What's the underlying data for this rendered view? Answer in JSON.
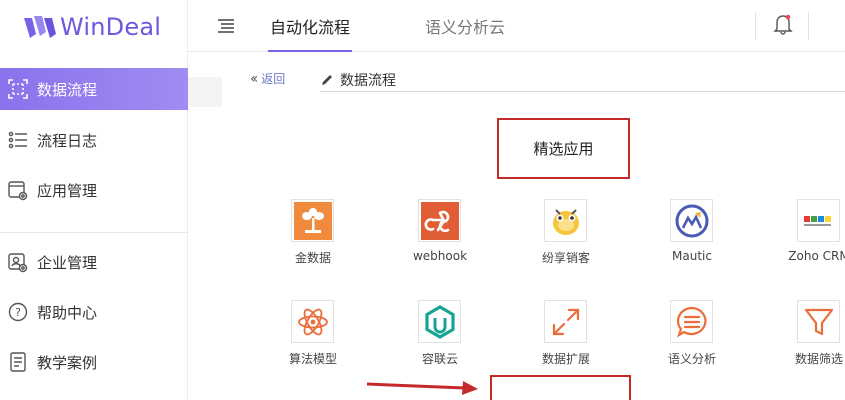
{
  "brand": {
    "name": "WinDeal",
    "color": "#7156e0"
  },
  "sidebar": {
    "items": [
      {
        "label": "数据流程",
        "icon": "flow-frame-icon",
        "active": true
      },
      {
        "label": "流程日志",
        "icon": "list-log-icon",
        "active": false
      },
      {
        "label": "应用管理",
        "icon": "app-settings-icon",
        "active": false
      },
      {
        "label": "企业管理",
        "icon": "enterprise-icon",
        "active": false
      },
      {
        "label": "帮助中心",
        "icon": "help-icon",
        "active": false
      },
      {
        "label": "教学案例",
        "icon": "document-icon",
        "active": false
      }
    ]
  },
  "header": {
    "tabs": [
      {
        "label": "自动化流程",
        "active": true
      },
      {
        "label": "语义分析云",
        "active": false
      }
    ],
    "icons": {
      "menu": "menu-icon",
      "notifications": "bell-icon"
    }
  },
  "breadcrumb": {
    "back_label": "返回",
    "flow_title": "数据流程"
  },
  "section": {
    "title": "精选应用"
  },
  "apps": [
    {
      "name": "金数据",
      "icon": "jinshuju-icon"
    },
    {
      "name": "webhook",
      "icon": "webhook-icon"
    },
    {
      "name": "纷享销客",
      "icon": "fxiaoke-icon"
    },
    {
      "name": "Mautic",
      "icon": "mautic-icon"
    },
    {
      "name": "Zoho CRM",
      "icon": "zoho-icon"
    },
    {
      "name": "算法模型",
      "icon": "atom-icon"
    },
    {
      "name": "容联云",
      "icon": "ronglian-icon"
    },
    {
      "name": "数据扩展",
      "icon": "expand-icon"
    },
    {
      "name": "语义分析",
      "icon": "chat-lines-icon"
    },
    {
      "name": "数据筛选",
      "icon": "filter-icon"
    }
  ],
  "colors": {
    "accent": "#7b62e8",
    "annotation": "#c42a2a",
    "app_orange": "#ec6d3c"
  }
}
